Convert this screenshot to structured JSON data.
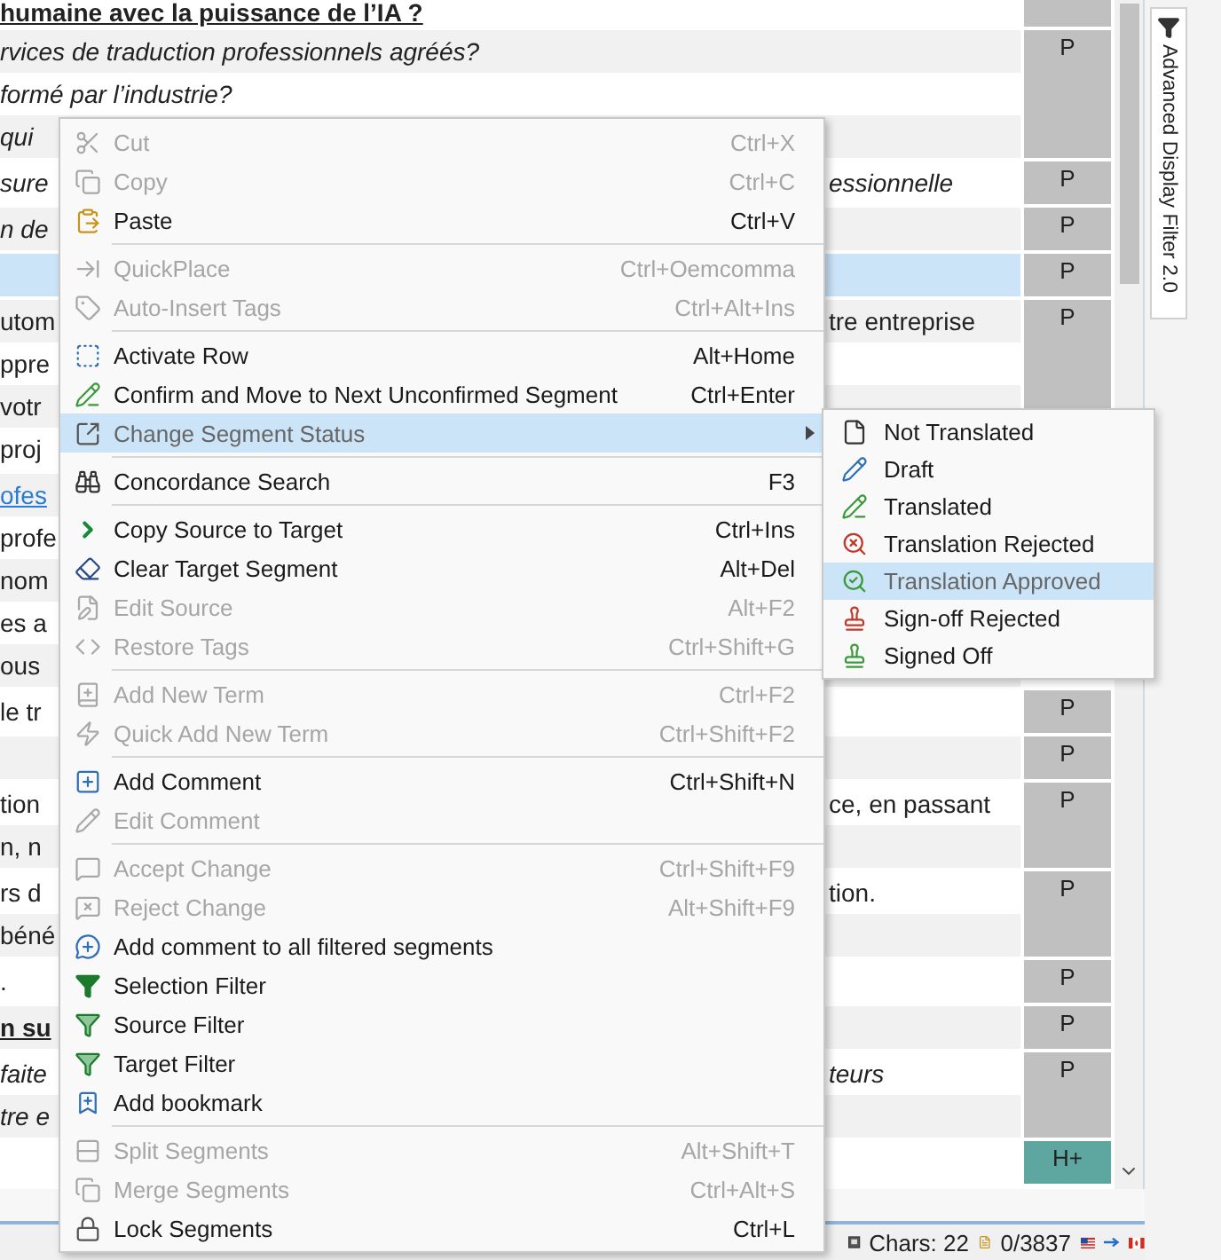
{
  "editor": {
    "segments": [
      {
        "color": "#c0c0c0",
        "selected": false,
        "lines": [
          {
            "kind": "heading",
            "left": "humaine avec la puissance de l’IA ?"
          }
        ]
      },
      {
        "status": "P",
        "color": "#c0c0c0",
        "selected": false,
        "lines": [
          {
            "kind": "italic",
            "left": "rvices de traduction professionnels agréés?"
          },
          {
            "kind": "italic",
            "left": "formé par l’industrie?"
          },
          {
            "kind": "italic",
            "left": "qui"
          }
        ]
      },
      {
        "status": "P",
        "color": "#c0c0c0",
        "selected": false,
        "lines": [
          {
            "kind": "italic",
            "left": "sure",
            "right": "essionnelle"
          }
        ]
      },
      {
        "status": "P",
        "color": "#c0c0c0",
        "selected": false,
        "lines": [
          {
            "kind": "italic",
            "left": "n de"
          }
        ]
      },
      {
        "status": "P",
        "color": "#c0c0c0",
        "selected": true
      },
      {
        "status": "P",
        "color": "#c0c0c0",
        "selected": false,
        "lines": [
          {
            "kind": "plain",
            "left": "utom",
            "right": "tre entreprise"
          },
          {
            "kind": "plain",
            "left": "ppre"
          },
          {
            "kind": "plain",
            "left": "votr"
          },
          {
            "kind": "plain",
            "left": "proj"
          }
        ]
      },
      {
        "selected": false,
        "lines": [
          {
            "kind": "link",
            "left": "ofes"
          },
          {
            "kind": "plain",
            "left": "profe"
          },
          {
            "kind": "plain",
            "left": "nom"
          },
          {
            "kind": "plain",
            "left": "es a"
          },
          {
            "kind": "plain",
            "left": "ous"
          }
        ]
      },
      {
        "status": "P",
        "color": "#c0c0c0",
        "selected": false,
        "lines": [
          {
            "kind": "plain",
            "left": "le tr"
          }
        ]
      },
      {
        "status": "P",
        "color": "#c0c0c0",
        "selected": false
      },
      {
        "status": "P",
        "color": "#c0c0c0",
        "selected": false,
        "lines": [
          {
            "kind": "plain",
            "left": "tion",
            "right": "ce, en passant"
          },
          {
            "kind": "plain",
            "left": "n, n"
          }
        ]
      },
      {
        "status": "P",
        "color": "#c0c0c0",
        "selected": false,
        "lines": [
          {
            "kind": "plain",
            "left": "rs d",
            "right": "tion."
          },
          {
            "kind": "plain",
            "left": "béné"
          }
        ]
      },
      {
        "status": "P",
        "color": "#c0c0c0",
        "selected": false,
        "lines": [
          {
            "kind": "plain",
            "left": "."
          }
        ]
      },
      {
        "status": "P",
        "color": "#c0c0c0",
        "selected": false,
        "lines": [
          {
            "kind": "heading",
            "left": "n su"
          }
        ]
      },
      {
        "status": "P",
        "color": "#c0c0c0",
        "selected": false,
        "lines": [
          {
            "kind": "italic",
            "left": "faite",
            "right": "teurs"
          },
          {
            "kind": "italic",
            "left": "tre e"
          }
        ]
      },
      {
        "status": "H+",
        "color": "#5ea7a1",
        "selected": false
      }
    ]
  },
  "status_bar": {
    "chars": "Chars: 22",
    "count": "0/3837"
  },
  "side_panel": {
    "tab": "Advanced Display Filter 2.0"
  },
  "context_menu": {
    "entries": [
      {
        "kind": "item",
        "label": "Cut",
        "shortcut": "Ctrl+X",
        "disabled": true,
        "selected": false
      },
      {
        "kind": "item",
        "label": "Copy",
        "shortcut": "Ctrl+C",
        "disabled": true,
        "selected": false
      },
      {
        "kind": "item",
        "label": "Paste",
        "shortcut": "Ctrl+V",
        "disabled": false,
        "selected": false
      },
      {
        "kind": "separator"
      },
      {
        "kind": "item",
        "label": "QuickPlace",
        "shortcut": "Ctrl+Oemcomma",
        "disabled": true,
        "selected": false
      },
      {
        "kind": "item",
        "label": "Auto-Insert Tags",
        "shortcut": "Ctrl+Alt+Ins",
        "disabled": true,
        "selected": false
      },
      {
        "kind": "separator"
      },
      {
        "kind": "item",
        "label": "Activate Row",
        "shortcut": "Alt+Home",
        "disabled": false,
        "selected": false
      },
      {
        "kind": "item",
        "label": "Confirm and Move to Next Unconfirmed Segment",
        "shortcut": "Ctrl+Enter",
        "disabled": false,
        "selected": false
      },
      {
        "kind": "item",
        "label": "Change Segment Status",
        "disabled": false,
        "selected": true,
        "submenu": [
          {
            "label": "Not Translated",
            "selected": false
          },
          {
            "label": "Draft",
            "selected": false
          },
          {
            "label": "Translated",
            "selected": false
          },
          {
            "label": "Translation Rejected",
            "selected": false
          },
          {
            "label": "Translation Approved",
            "selected": true
          },
          {
            "label": "Sign-off Rejected",
            "selected": false
          },
          {
            "label": "Signed Off",
            "selected": false
          }
        ]
      },
      {
        "kind": "separator"
      },
      {
        "kind": "item",
        "label": "Concordance Search",
        "shortcut": "F3",
        "disabled": false,
        "selected": false
      },
      {
        "kind": "separator"
      },
      {
        "kind": "item",
        "label": "Copy Source to Target",
        "shortcut": "Ctrl+Ins",
        "disabled": false,
        "selected": false
      },
      {
        "kind": "item",
        "label": "Clear Target Segment",
        "shortcut": "Alt+Del",
        "disabled": false,
        "selected": false
      },
      {
        "kind": "item",
        "label": "Edit Source",
        "shortcut": "Alt+F2",
        "disabled": true,
        "selected": false
      },
      {
        "kind": "item",
        "label": "Restore Tags",
        "shortcut": "Ctrl+Shift+G",
        "disabled": true,
        "selected": false
      },
      {
        "kind": "separator"
      },
      {
        "kind": "item",
        "label": "Add New Term",
        "shortcut": "Ctrl+F2",
        "disabled": true,
        "selected": false
      },
      {
        "kind": "item",
        "label": "Quick Add New Term",
        "shortcut": "Ctrl+Shift+F2",
        "disabled": true,
        "selected": false
      },
      {
        "kind": "separator"
      },
      {
        "kind": "item",
        "label": "Add Comment",
        "shortcut": "Ctrl+Shift+N",
        "disabled": false,
        "selected": false
      },
      {
        "kind": "item",
        "label": "Edit Comment",
        "disabled": true,
        "selected": false
      },
      {
        "kind": "separator"
      },
      {
        "kind": "item",
        "label": "Accept Change",
        "shortcut": "Ctrl+Shift+F9",
        "disabled": true,
        "selected": false
      },
      {
        "kind": "item",
        "label": "Reject Change",
        "shortcut": "Alt+Shift+F9",
        "disabled": true,
        "selected": false
      },
      {
        "kind": "item",
        "label": "Add comment to all filtered segments",
        "disabled": false,
        "selected": false
      },
      {
        "kind": "item",
        "label": "Selection Filter",
        "disabled": false,
        "selected": false
      },
      {
        "kind": "item",
        "label": "Source Filter",
        "disabled": false,
        "selected": false
      },
      {
        "kind": "item",
        "label": "Target Filter",
        "disabled": false,
        "selected": false
      },
      {
        "kind": "item",
        "label": "Add bookmark",
        "disabled": false,
        "selected": false
      },
      {
        "kind": "separator"
      },
      {
        "kind": "item",
        "label": "Split Segments",
        "shortcut": "Alt+Shift+T",
        "disabled": true,
        "selected": false
      },
      {
        "kind": "item",
        "label": "Merge Segments",
        "shortcut": "Ctrl+Alt+S",
        "disabled": true,
        "selected": false
      },
      {
        "kind": "item",
        "label": "Lock Segments",
        "shortcut": "Ctrl+L",
        "disabled": false,
        "selected": false
      }
    ]
  }
}
